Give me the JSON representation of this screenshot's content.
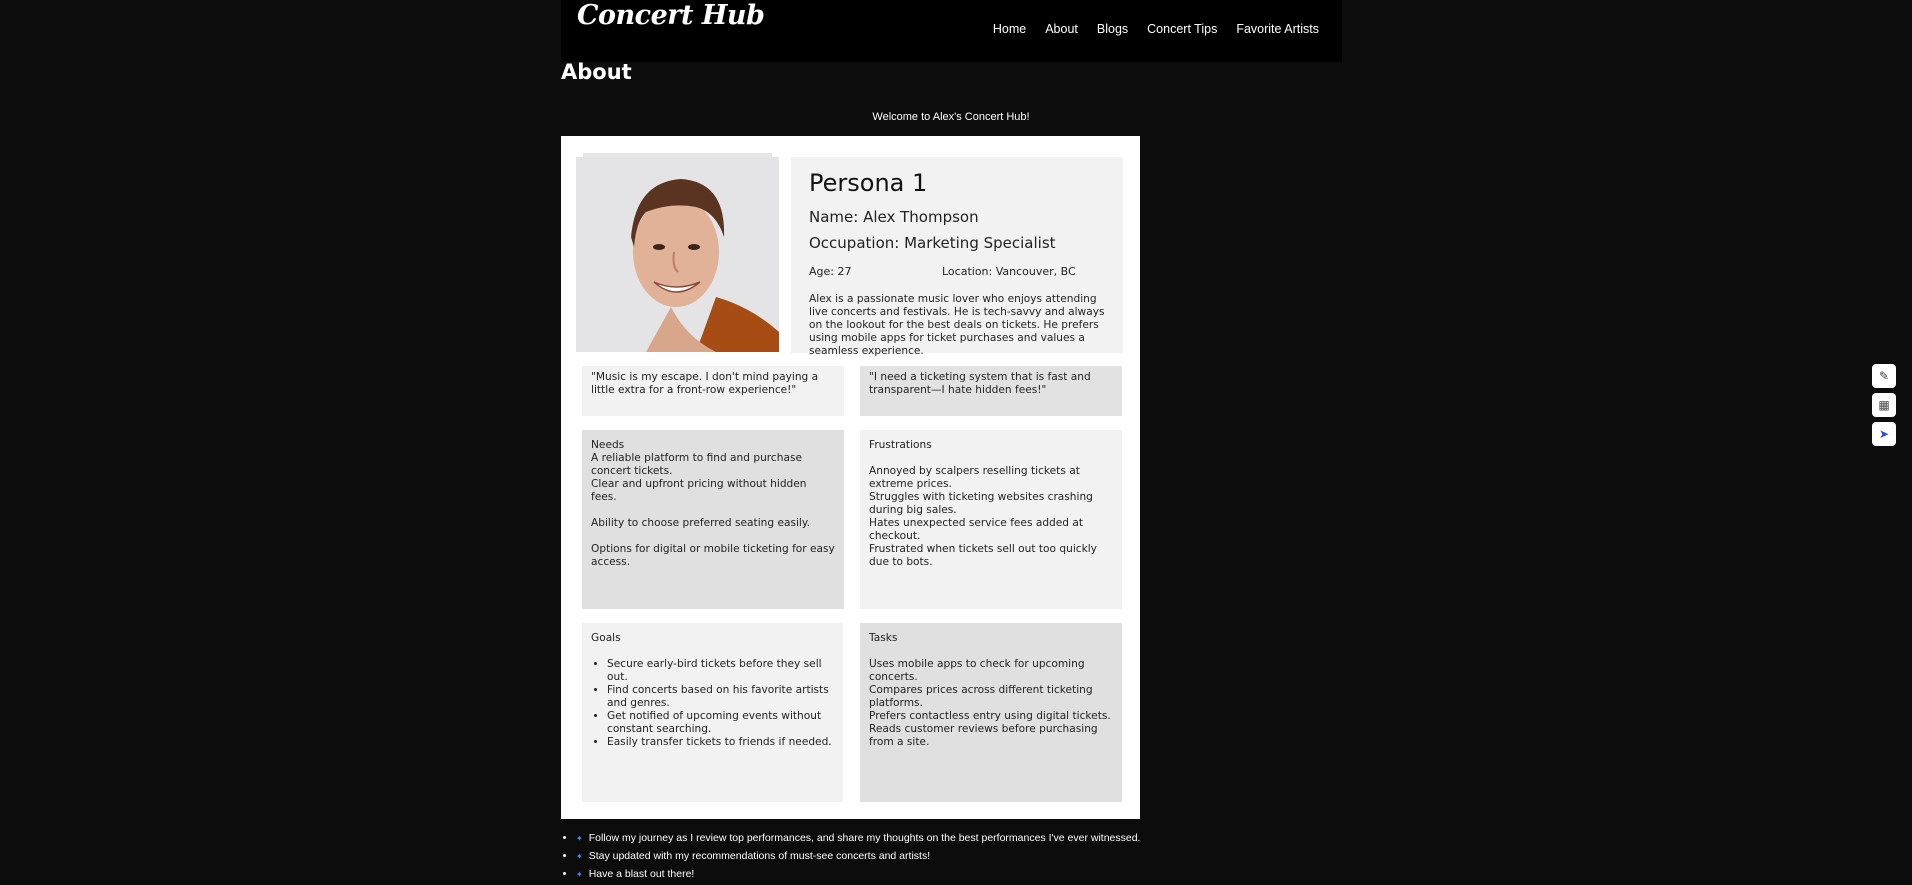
{
  "header": {
    "logo": "Concert Hub",
    "nav": [
      "Home",
      "About",
      "Blogs",
      "Concert Tips",
      "Favorite Artists"
    ]
  },
  "page": {
    "title": "About",
    "welcome": "Welcome to Alex's Concert Hub!"
  },
  "persona": {
    "title": "Persona 1",
    "name": "Name: Alex Thompson",
    "occupation": "Occupation: Marketing Specialist",
    "age": "Age: 27",
    "location": "Location: Vancouver, BC",
    "bio": "Alex is a passionate music lover who enjoys attending live concerts and festivals. He is tech-savvy and always on the lookout for the best deals on tickets. He prefers using mobile apps for ticket purchases and values a seamless experience.",
    "quote1": "\"Music is my escape. I don't mind paying a little extra for a front-row experience!\"",
    "quote2": "\"I need a ticketing system that is fast and transparent—I hate hidden fees!\"",
    "needs": {
      "heading": "Needs",
      "items": [
        "A reliable platform to find and purchase concert tickets.",
        "Clear and upfront pricing without hidden fees.",
        "Ability to choose preferred seating easily.",
        "Options for digital or mobile ticketing for easy access."
      ]
    },
    "frustrations": {
      "heading": "Frustrations",
      "items": [
        "Annoyed by scalpers reselling tickets at extreme prices.",
        "Struggles with ticketing websites crashing during big sales.",
        "Hates unexpected service fees added at checkout.",
        "Frustrated when tickets sell out too quickly due to bots."
      ]
    },
    "goals": {
      "heading": "Goals",
      "items": [
        "Secure early-bird tickets before they sell out.",
        "Find concerts based on his favorite artists and genres.",
        "Get notified of upcoming events without constant searching.",
        "Easily transfer tickets to friends if needed."
      ]
    },
    "tasks": {
      "heading": "Tasks",
      "items": [
        "Uses mobile apps to check for upcoming concerts.",
        "Compares prices across different ticketing platforms.",
        "Prefers contactless entry using digital tickets.",
        "Reads customer reviews before purchasing from a site."
      ]
    }
  },
  "bullets": [
    "Follow my journey as I review top performances, and share my thoughts on the best performances I've ever witnessed.",
    "Stay updated with my recommendations of must-see concerts and artists!",
    "Have a blast out there!"
  ],
  "side_tools": [
    "edit-icon",
    "calendar-icon",
    "send-icon"
  ],
  "colors": {
    "background": "#0c0c0c",
    "header": "#000000",
    "accent": "#4a8df6"
  }
}
